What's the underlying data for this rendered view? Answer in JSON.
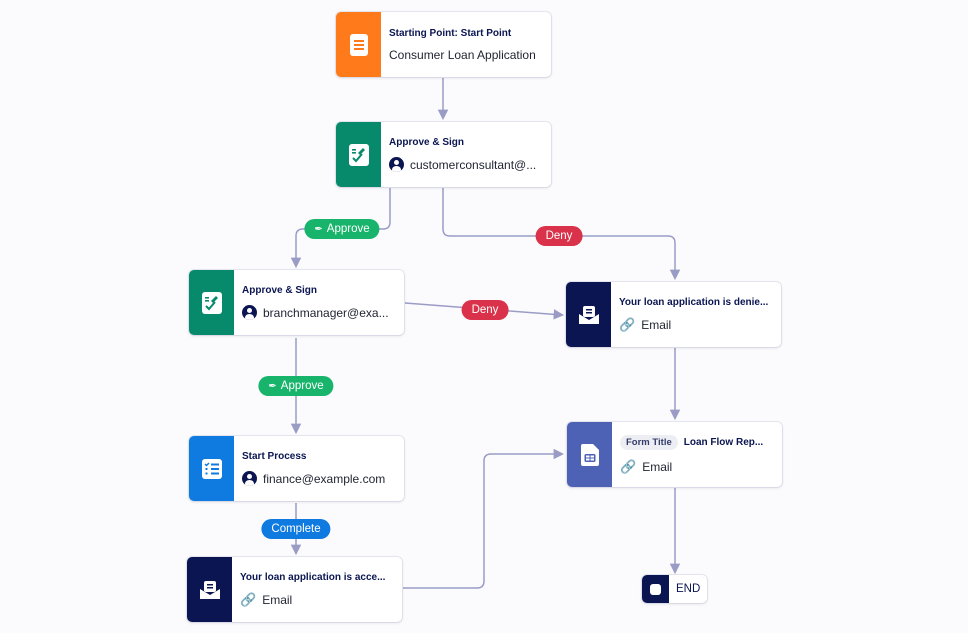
{
  "colors": {
    "edge": "#9a9cc6",
    "approve": "#18b46b",
    "deny": "#d9324a",
    "complete": "#0f7ae0",
    "start": "#ff7a1a",
    "sign": "#078a6b",
    "process": "#0f7ae0",
    "email": "#0a1551",
    "report": "#4d62b5",
    "end": "#0a1551"
  },
  "nodes": {
    "start": {
      "icon": "form-icon",
      "title": "Starting Point: Start Point",
      "subtitle": "Consumer Loan Application"
    },
    "approve_sign_1": {
      "icon": "approve-sign-icon",
      "title": "Approve & Sign",
      "assignee": "customerconsultant@..."
    },
    "approve_sign_2": {
      "icon": "approve-sign-icon",
      "title": "Approve & Sign",
      "assignee": "branchmanager@exa..."
    },
    "start_process": {
      "icon": "checklist-icon",
      "title": "Start Process",
      "assignee": "finance@example.com"
    },
    "email_accepted": {
      "icon": "email-icon",
      "title": "Your loan application is acce...",
      "type": "Email"
    },
    "email_denied": {
      "icon": "email-icon",
      "title": "Your loan application is denie...",
      "type": "Email"
    },
    "report": {
      "icon": "report-icon",
      "chip": "Form Title",
      "title": "Loan Flow Rep...",
      "type": "Email"
    },
    "end": {
      "label": "END"
    }
  },
  "badges": {
    "approve_1": "Approve",
    "deny_1": "Deny",
    "deny_2": "Deny",
    "approve_2": "Approve",
    "complete": "Complete"
  }
}
